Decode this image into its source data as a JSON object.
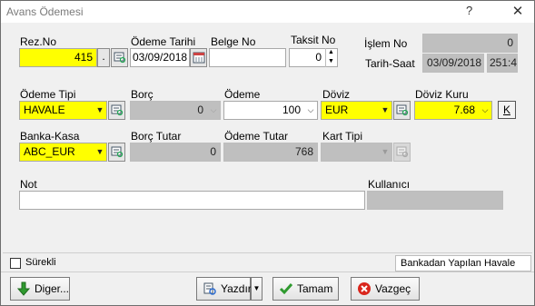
{
  "window": {
    "title": "Avans Ödemesi",
    "help": "?",
    "close": "✕"
  },
  "labels": {
    "rez_no": "Rez.No",
    "odeme_tarihi": "Ödeme Tarihi",
    "belge_no": "Belge No",
    "taksit_no": "Taksit No",
    "islem_no": "İşlem No",
    "tarih_saat": "Tarih-Saat",
    "odeme_tipi": "Ödeme Tipi",
    "borc": "Borç",
    "odeme": "Ödeme",
    "doviz": "Döviz",
    "doviz_kuru": "Döviz Kuru",
    "banka_kasa": "Banka-Kasa",
    "borc_tutar": "Borç Tutar",
    "odeme_tutar": "Ödeme Tutar",
    "kart_tipi": "Kart Tipi",
    "not": "Not",
    "kullanici": "Kullanıcı"
  },
  "fields": {
    "rez_no": "415",
    "rez_no_btn": ".",
    "odeme_tarihi": "03/09/2018",
    "belge_no": "",
    "taksit_no": "0",
    "islem_no": "0",
    "tarih": "03/09/2018",
    "saat": "251:4",
    "odeme_tipi": "HAVALE",
    "borc": "0",
    "odeme": "100",
    "doviz": "EUR",
    "doviz_kuru": "7.68",
    "kur_btn": "K",
    "banka_kasa": "ABC_EUR",
    "borc_tutar": "0",
    "odeme_tutar": "768",
    "kart_tipi": "",
    "not": "",
    "kullanici": ""
  },
  "status": {
    "surekli_label": "Sürekli",
    "surekli_checked": false,
    "message": "Bankadan Yapılan Havale"
  },
  "buttons": {
    "diger": "Diger...",
    "yazdir": "Yazdır",
    "tamam": "Tamam",
    "vazgec": "Vazgeç"
  },
  "colors": {
    "required_field": "#ffff00",
    "disabled_field": "#bfbfbf",
    "window_bg": "#f0f0f0"
  }
}
